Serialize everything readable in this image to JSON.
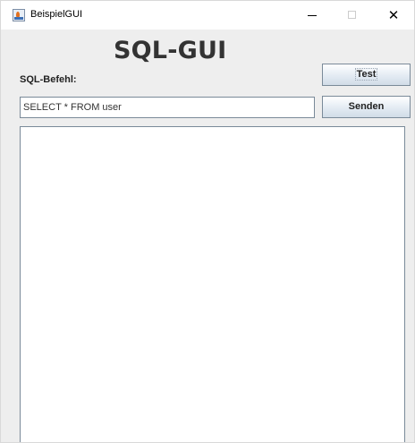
{
  "window": {
    "title": "BeispielGUI",
    "icon": "java-coffee-icon",
    "controls": {
      "minimize": "–",
      "maximize": "□",
      "close": "✕"
    }
  },
  "main": {
    "heading": "SQL-GUI",
    "sql_label": "SQL-Befehl:",
    "query_value": "SELECT * FROM user",
    "test_button": "Test",
    "send_button": "Senden",
    "result_text": ""
  }
}
